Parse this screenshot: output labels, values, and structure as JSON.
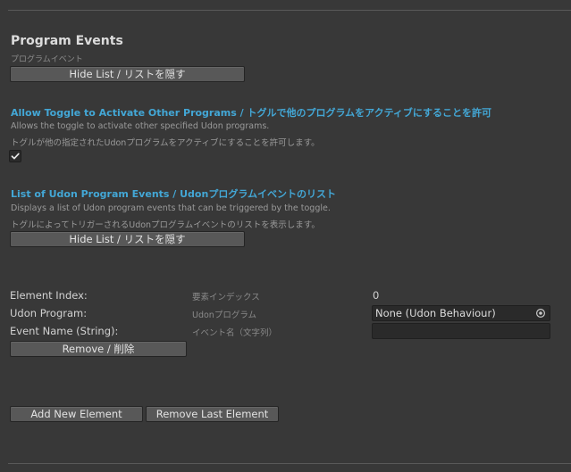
{
  "program_events": {
    "title": "Program Events",
    "subtitle": "プログラムイベント",
    "hide_list_label": "Hide List / リストを隠す"
  },
  "allow_toggle": {
    "title": "Allow Toggle to Activate Other Programs / トグルで他のプログラムをアクティブにすることを許可",
    "desc_en": "Allows the toggle to activate other specified Udon programs.",
    "desc_ja": "トグルが他の指定されたUdonプログラムをアクティブにすることを許可します。",
    "checked": true
  },
  "event_list": {
    "title": "List of Udon Program Events / Udonプログラムイベントのリスト",
    "desc_en": "Displays a list of Udon program events that can be triggered by the toggle.",
    "desc_ja": "トグルによってトリガーされるUdonプログラムイベントのリストを表示します。",
    "hide_list_label": "Hide List / リストを隠す"
  },
  "element": {
    "index_label": "Element Index:",
    "index_label_ja": "要素インデックス",
    "index_value": "0",
    "program_label": "Udon Program:",
    "program_label_ja": "Udonプログラム",
    "program_value": "None (Udon Behaviour)",
    "event_label": "Event Name (String):",
    "event_label_ja": "イベント名（文字列）",
    "event_value": "",
    "remove_label": "Remove / 削除"
  },
  "footer": {
    "add_label": "Add New Element",
    "remove_last_label": "Remove Last Element"
  },
  "colors": {
    "background": "#383838",
    "accent_link": "#43a7d6",
    "button": "#585858"
  },
  "icons": {
    "checkbox": "checkmark-icon",
    "object_picker": "object-picker-icon"
  }
}
